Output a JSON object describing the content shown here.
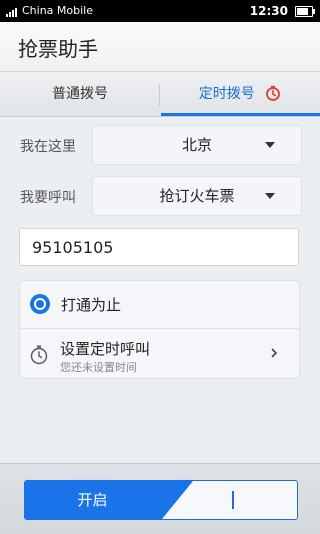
{
  "status_bar": {
    "carrier": "China Mobile",
    "time": "12:30"
  },
  "title_bar": {
    "title": "抢票助手"
  },
  "tabs": [
    {
      "label": "普通拨号",
      "selected": false
    },
    {
      "label": "定时拨号",
      "selected": true,
      "icon": "clock-icon"
    }
  ],
  "form": {
    "location_label": "我在这里",
    "location_value": "北京",
    "call_label": "我要呼叫",
    "call_value": "抢订火车票",
    "phone_value": "95105105"
  },
  "options": {
    "until_connected": {
      "label": "打通为止",
      "selected": true
    },
    "scheduled_call": {
      "label": "设置定时呼叫",
      "sublabel": "您还未设置时间"
    }
  },
  "footer": {
    "toggle_label": "开启"
  },
  "colors": {
    "accent": "#1a73e8"
  }
}
